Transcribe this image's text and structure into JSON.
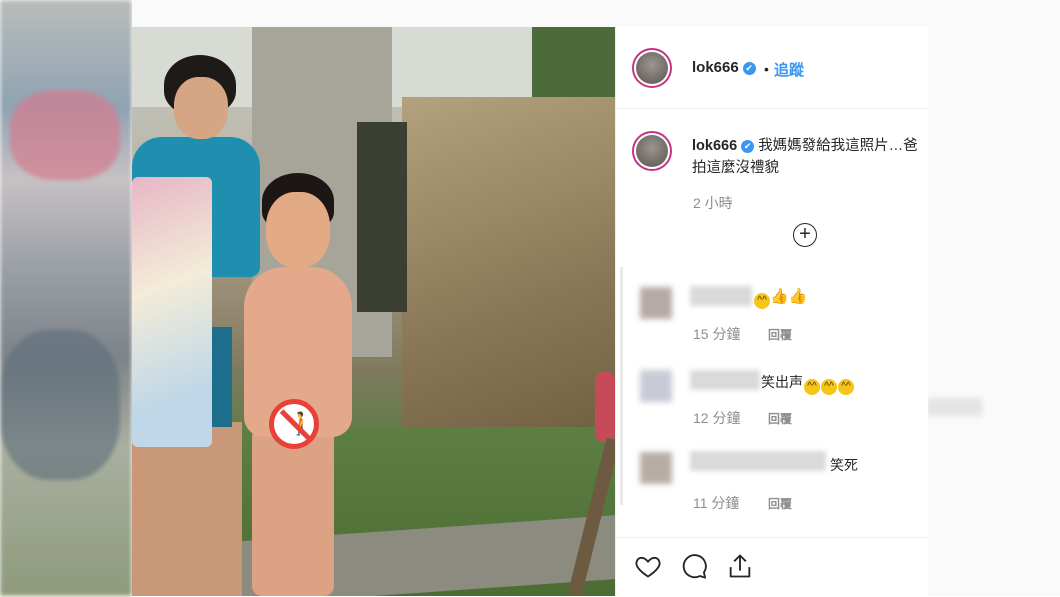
{
  "post": {
    "username": "lok666",
    "verified_mark": "✔",
    "separator": "•",
    "follow_label": "追蹤",
    "caption": "我媽媽發給我這照片…爸",
    "caption_line2": "拍這麼沒禮貌",
    "time_ago": "2 小時",
    "load_more_icon": "plus-circle-icon"
  },
  "comments": [
    {
      "text": "",
      "suffix": "😄👍👍",
      "time": "15 分鐘",
      "reply": "回覆"
    },
    {
      "text": "笑出声",
      "suffix": "😄😄😄",
      "time": "12 分鐘",
      "reply": "回覆"
    },
    {
      "text": "笑死",
      "suffix": "",
      "time": "11 分鐘",
      "reply": "回覆"
    }
  ],
  "actions": {
    "like_icon": "heart-icon",
    "comment_icon": "comment-icon",
    "share_icon": "share-icon"
  },
  "colors": {
    "link_blue": "#3897f0",
    "verified_blue": "#3897f0",
    "avatar_ring": "#c13584",
    "censor_red": "#e8413a"
  }
}
